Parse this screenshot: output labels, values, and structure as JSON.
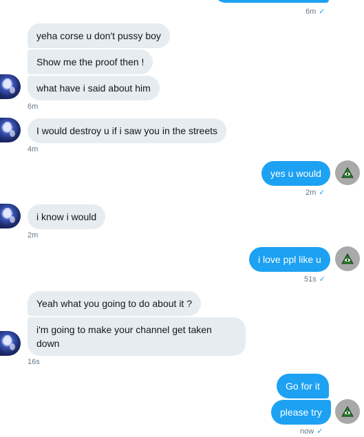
{
  "top_time": "6m",
  "messages": [
    {
      "text": "yeha corse u don't pussy boy"
    },
    {
      "text": "Show me the proof then !"
    },
    {
      "text": "what have i said about him"
    },
    {
      "text": "I would destroy u if i saw you in the streets"
    },
    {
      "text": "yes u would"
    },
    {
      "text": "i know i would"
    },
    {
      "text": "i love ppl like u"
    },
    {
      "text": "Yeah what you going to do about it ?"
    },
    {
      "text_line1": "i'm going to make your channel get taken",
      "text_line2": "down"
    },
    {
      "text": "Go for it"
    },
    {
      "text": "please try"
    }
  ],
  "timestamps": {
    "t1": "6m",
    "t2": "4m",
    "t3": "2m",
    "t4": "2m",
    "t5": "51s",
    "t6": "16s",
    "t7": "now"
  },
  "read_tick": "✓",
  "colors": {
    "sent_bubble": "#1da1f2",
    "received_bubble": "#e6ecf0",
    "timestamp": "#657786"
  },
  "icons": {
    "sender_avatar": "illuminati-eye-icon"
  }
}
